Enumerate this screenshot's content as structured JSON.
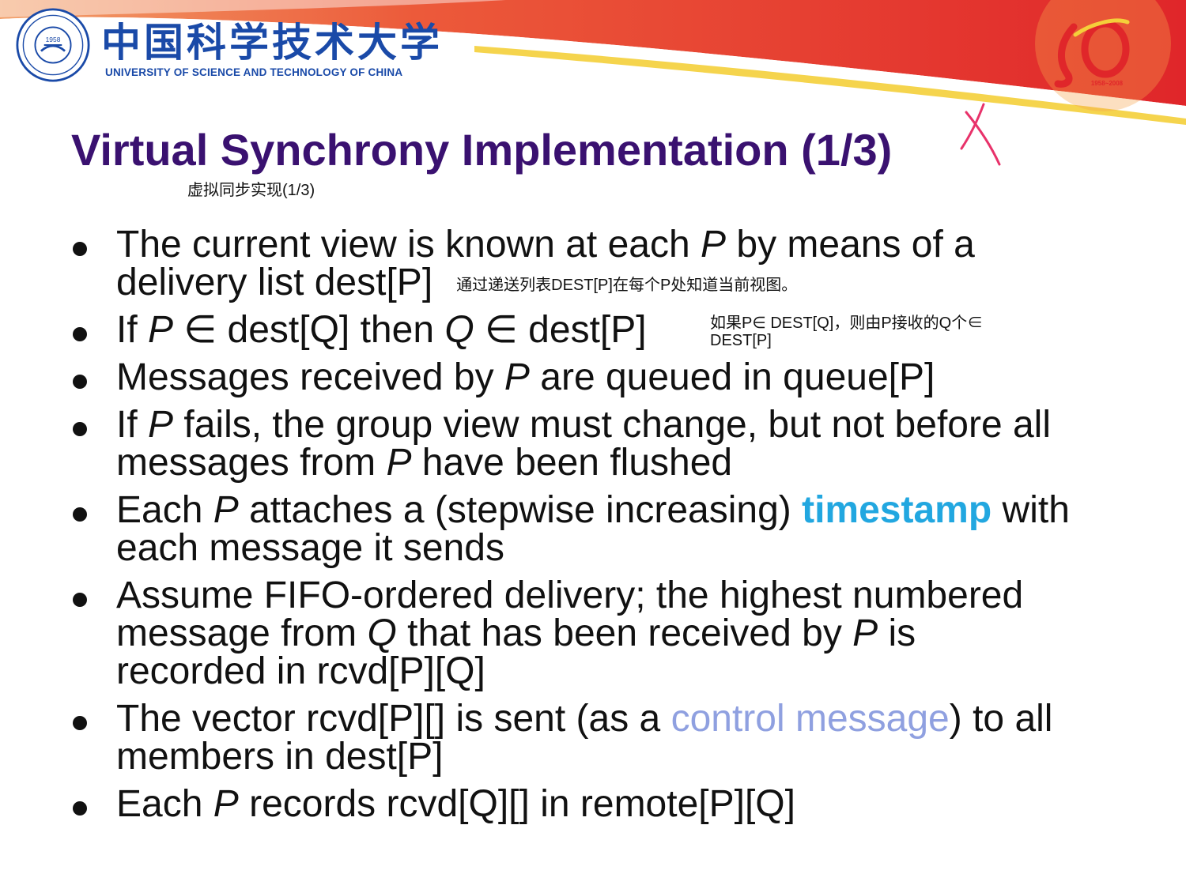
{
  "header": {
    "university_cn": "中国科学技术大学",
    "university_en": "UNIVERSITY OF SCIENCE AND TECHNOLOGY OF CHINA",
    "seal_year": "1958",
    "anniversary_years": "1958~2008"
  },
  "slide": {
    "title": "Virtual Synchrony Implementation (1/3)",
    "title_note": "虚拟同步实现(1/3)",
    "bullets": [
      {
        "line1": [
          "The current view is known at each ",
          "P",
          " by means of a"
        ],
        "line2": "delivery list dest[P]",
        "note": "通过递送列表DEST[P]在每个P处知道当前视图。"
      },
      {
        "parts": [
          "If ",
          "P",
          " ∈ dest[Q] then ",
          "Q",
          " ∈ dest[P]"
        ],
        "note_line1": "如果P∈ DEST[Q]，则由P接收的Q个∈",
        "note_line2": "DEST[P]"
      },
      {
        "parts": [
          "Messages received by ",
          "P",
          " are queued in queue[P]"
        ]
      },
      {
        "line1": [
          "If ",
          "P",
          " fails, the group view must change, but not before all"
        ],
        "line2": [
          "messages from ",
          "P",
          " have been flushed"
        ]
      },
      {
        "line1": [
          "Each ",
          "P",
          " attaches a (stepwise increasing) ",
          "timestamp",
          " with"
        ],
        "line2": "each message it sends"
      },
      {
        "line1": "Assume FIFO-ordered delivery; the highest numbered",
        "line2": [
          "message from ",
          "Q",
          " that has been received by ",
          "P",
          " is"
        ],
        "line3": "recorded in rcvd[P][Q]"
      },
      {
        "line1": [
          "The vector rcvd[P][] is sent (as a ",
          "control message",
          ") to all"
        ],
        "line2": "members in dest[P]"
      },
      {
        "parts": [
          "Each ",
          "P",
          " records rcvd[Q][] in remote[P][Q]"
        ]
      }
    ]
  },
  "colors": {
    "title": "#3a1170",
    "timestamp_highlight": "#22a7e0",
    "control_message_highlight": "#8fa0e0",
    "annotation_x": "#e8326a",
    "banner_red": "#e02a2a",
    "banner_yellow": "#f4cf3a"
  }
}
